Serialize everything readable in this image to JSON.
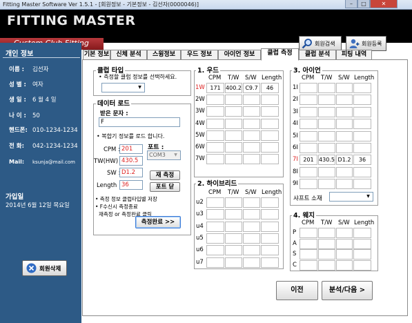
{
  "window": {
    "title": "Fitting Master Software Ver 1.5.1 - [회원정보 - 기본정보 - 김선자(0000046)]"
  },
  "header": {
    "app_name": "FITTING MASTER",
    "subtitle": "Custom Club Fitting",
    "search_btn": "회원검색",
    "register_btn": "회원등록"
  },
  "sidebar": {
    "title": "개인 정보",
    "rows": [
      {
        "label": "이름 :",
        "value": "김선자"
      },
      {
        "label": "성 별 :",
        "value": "여자"
      },
      {
        "label": "생 일 :",
        "value": "6 월 4 일"
      },
      {
        "label": "나 이 :",
        "value": "50"
      },
      {
        "label": "핸드폰:",
        "value": "010-1234-1234"
      },
      {
        "label": "전 화:",
        "value": "042-1234-1234"
      },
      {
        "label": "Mail:",
        "value": "ksunja@mail.com"
      }
    ],
    "joined_label": "가입일",
    "joined_date": "2014년 6월 12일 목요일",
    "delete_btn": "회원삭제"
  },
  "tabs": [
    "기본 정보",
    "신체 분석",
    "스윙정보",
    "우드 정보",
    "아이언 정보",
    "클럽 측정",
    "클럽 분석",
    "피팅 내역"
  ],
  "active_tab": "클럽 측정",
  "club_type": {
    "title": "클럽 타입",
    "hint": "• 측정할 클럽 정보를 선택하세요."
  },
  "data_load": {
    "title": "데이터 로드",
    "recv_label": "받은 문자 :",
    "recv_value": "F",
    "hint": "• 복합기 정보를 로드 합니다.",
    "cpm_label": "CPM :",
    "cpm_value": "201",
    "tw_label": "TW(HW) :",
    "tw_value": "430.5",
    "sw_label": "SW :",
    "sw_value": "D1.2",
    "len_label": "Length :",
    "len_value": "36",
    "port_label": "포트 :",
    "port_value": "COM3",
    "remeasure_btn": "재 측정",
    "port_btn": "포트 닫",
    "notes": [
      "• 측정 정보 클럽타입별 저장",
      "• F수신시 측정종료",
      "재측정 or 측정완료 클릭"
    ],
    "complete_btn": "측정완료 >>"
  },
  "wood": {
    "title": "1. 우드",
    "headers": [
      "CPM",
      "T/W",
      "S/W",
      "Length"
    ],
    "rows": [
      {
        "label": "1W",
        "values": [
          "171",
          "400.2",
          "C9.7",
          "46"
        ],
        "highlight": true
      },
      {
        "label": "2W",
        "values": [
          "",
          "",
          "",
          ""
        ]
      },
      {
        "label": "3W",
        "values": [
          "",
          "",
          "",
          ""
        ]
      },
      {
        "label": "4W",
        "values": [
          "",
          "",
          "",
          ""
        ]
      },
      {
        "label": "5W",
        "values": [
          "",
          "",
          "",
          ""
        ]
      },
      {
        "label": "6W",
        "values": [
          "",
          "",
          "",
          ""
        ]
      },
      {
        "label": "7W",
        "values": [
          "",
          "",
          "",
          ""
        ]
      }
    ]
  },
  "hybrid": {
    "title": "2. 하이브리드",
    "headers": [
      "CPM",
      "T/W",
      "S/W",
      "Length"
    ],
    "rows": [
      {
        "label": "u2",
        "values": [
          "",
          "",
          "",
          ""
        ]
      },
      {
        "label": "u3",
        "values": [
          "",
          "",
          "",
          ""
        ]
      },
      {
        "label": "u4",
        "values": [
          "",
          "",
          "",
          ""
        ]
      },
      {
        "label": "u5",
        "values": [
          "",
          "",
          "",
          ""
        ]
      },
      {
        "label": "u6",
        "values": [
          "",
          "",
          "",
          ""
        ]
      },
      {
        "label": "u7",
        "values": [
          "",
          "",
          "",
          ""
        ]
      }
    ]
  },
  "iron": {
    "title": "3. 아이언",
    "headers": [
      "CPM",
      "T/W",
      "S/W",
      "Length"
    ],
    "rows": [
      {
        "label": "1I",
        "values": [
          "",
          "",
          "",
          ""
        ]
      },
      {
        "label": "2I",
        "values": [
          "",
          "",
          "",
          ""
        ]
      },
      {
        "label": "3I",
        "values": [
          "",
          "",
          "",
          ""
        ]
      },
      {
        "label": "4I",
        "values": [
          "",
          "",
          "",
          ""
        ]
      },
      {
        "label": "5I",
        "values": [
          "",
          "",
          "",
          ""
        ]
      },
      {
        "label": "6I",
        "values": [
          "",
          "",
          "",
          ""
        ]
      },
      {
        "label": "7I",
        "values": [
          "201",
          "430.5",
          "D1.2",
          "36"
        ],
        "highlight": true
      },
      {
        "label": "8I",
        "values": [
          "",
          "",
          "",
          ""
        ]
      },
      {
        "label": "9I",
        "values": [
          "",
          "",
          "",
          ""
        ]
      }
    ],
    "shaft_label": "샤프트 소재"
  },
  "wedge": {
    "title": "4. 웨지",
    "headers": [
      "CPM",
      "T/W",
      "S/W",
      "Length"
    ],
    "rows": [
      {
        "label": "P",
        "values": [
          "",
          "",
          "",
          ""
        ]
      },
      {
        "label": "A",
        "values": [
          "",
          "",
          "",
          ""
        ]
      },
      {
        "label": "S",
        "values": [
          "",
          "",
          "",
          ""
        ]
      },
      {
        "label": "C",
        "values": [
          "",
          "",
          "",
          ""
        ]
      }
    ]
  },
  "footer": {
    "prev_btn": "이전",
    "next_btn": "분석/다음 >"
  }
}
